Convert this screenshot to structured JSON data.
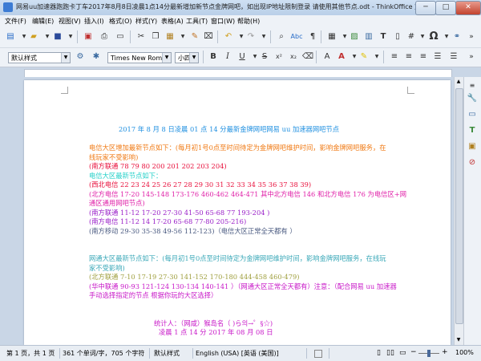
{
  "window": {
    "title": "网易uu加速器跑跑卡丁车2017年8月8日凌晨1点14分最新增加新节点金牌网吧，如出现IP地址限制登录 请使用其他节点.odt - ThinkOffice 文字",
    "minimize": "─",
    "maximize": "□",
    "close": "✕"
  },
  "menu": [
    {
      "label": "文件(F)"
    },
    {
      "label": "编辑(E)"
    },
    {
      "label": "视图(V)"
    },
    {
      "label": "插入(I)"
    },
    {
      "label": "格式(O)"
    },
    {
      "label": "样式(Y)"
    },
    {
      "label": "表格(A)"
    },
    {
      "label": "工具(T)"
    },
    {
      "label": "窗口(W)"
    },
    {
      "label": "帮助(H)"
    }
  ],
  "toolbar2": {
    "paragraph_style": "默认样式",
    "font_name": "Times New Roma",
    "font_size": "小四"
  },
  "document": {
    "lines": [
      {
        "text": "2017 年 8 月 8 日凌晨 01 点 14 分最新金牌网吧网易 uu 加速器网吧节点",
        "color": "#1e8fe0"
      },
      {
        "text": "",
        "color": "#000000"
      },
      {
        "text": "电信大区增加最新节点如下：(每月初1号0点至时间待定为金牌网吧维护时间，影响金牌网吧服务，在",
        "color": "#f07a14"
      },
      {
        "text": "线玩家不受影响)",
        "color": "#f07a14"
      },
      {
        "text": "(南方联通 78 79 80 200 201 202 203 204)",
        "color": "#e8103c"
      },
      {
        "text": "电信大区最新节点如下：",
        "color": "#22d0c8"
      },
      {
        "text": "(西北电信 22 23 24 25 26 27 28 29 30 31 32 33 34 35 36 37 38 39)",
        "color": "#e8103c"
      },
      {
        "text": "(北方电信 17-20 145-148 173-176 460-462 464-471  其中北方电信 146 和北方电信 176 为电信区+网",
        "color": "#e020a8"
      },
      {
        "text": "通区通用网吧节点)",
        "color": "#e020a8"
      },
      {
        "text": "(南方联通 11-12 17-20 27-30 41-50 65-68  77  193-204 )",
        "color": "#9a20c8"
      },
      {
        "text": "(南方电信 11-12 14 17-20 65-68 77-80 205-216)",
        "color": "#9a20c8"
      },
      {
        "text": "(南方移动 29-30 35-38 49-56 112-123)（电信大区正常全天都有 ）",
        "color": "#4a5a80"
      },
      {
        "text": "",
        "color": "#000000"
      },
      {
        "text": "",
        "color": "#000000"
      },
      {
        "text": "网通大区最新节点如下：(每月初1号0点至时间待定为金牌网吧维护时间，影响金牌网吧服务，在线玩",
        "color": "#3aa8b8"
      },
      {
        "text": "家不受影响)",
        "color": "#3aa8b8"
      },
      {
        "text": "(北方联通 7-10 17-19 27-30 141-152 170-180 444-458 460-479)",
        "color": "#a0a040"
      },
      {
        "text": "(华中联通  90-93 121-124 130-134 140-141 ）（网通大区正常全天都有）注意：（配合网易 uu 加速器",
        "color": "#c818c8"
      },
      {
        "text": "手动选择指定的节点 根据你玩的大区选择）",
        "color": "#c818c8"
      },
      {
        "text": "",
        "color": "#000000"
      },
      {
        "text": "",
        "color": "#000000"
      },
      {
        "text": "统计人：（网咸）猴岛名（ )ら의→゜§☆)",
        "color": "#c818c8"
      },
      {
        "text": "凌晨 1 点 14 分        2017 年 08 月 08 日",
        "color": "#c818c8"
      }
    ]
  },
  "status": {
    "page": "第 1 页，共 1 页",
    "words": "361 个单词/字，705 个字符",
    "style": "默认样式",
    "language": "English (USA) [英语 (美国)]",
    "zoom": "100%"
  }
}
